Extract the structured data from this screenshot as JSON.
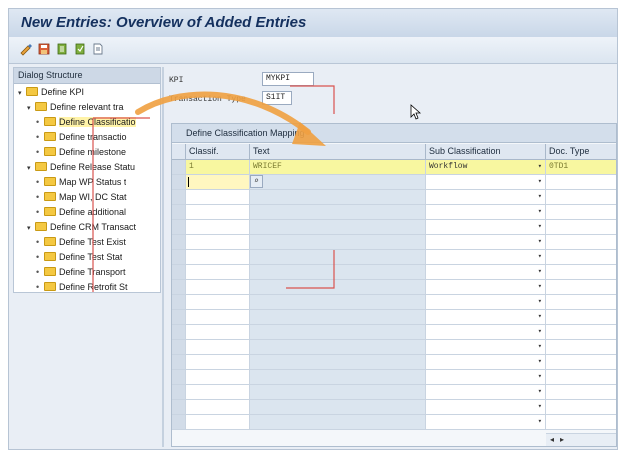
{
  "title": "New Entries: Overview of Added Entries",
  "toolbar": {
    "buttons": [
      "display-change-icon",
      "save-icon",
      "copy-icon",
      "select-all-icon",
      "document-icon"
    ]
  },
  "dialog": {
    "header": "Dialog Structure",
    "items": [
      {
        "level": 0,
        "type": "expanded",
        "label": "Define KPI"
      },
      {
        "level": 1,
        "type": "expanded",
        "label": "Define relevant tra"
      },
      {
        "level": 2,
        "type": "leaf",
        "label": "Define Classificatio",
        "selected": true
      },
      {
        "level": 2,
        "type": "leaf",
        "label": "Define transactio"
      },
      {
        "level": 2,
        "type": "leaf",
        "label": "Define milestone"
      },
      {
        "level": 1,
        "type": "expanded",
        "label": "Define Release Statu"
      },
      {
        "level": 2,
        "type": "leaf",
        "label": "Map WP Status t"
      },
      {
        "level": 2,
        "type": "leaf",
        "label": "Map WI, DC Stat"
      },
      {
        "level": 2,
        "type": "leaf",
        "label": "Define additional"
      },
      {
        "level": 1,
        "type": "expanded",
        "label": "Define CRM Transact"
      },
      {
        "level": 2,
        "type": "leaf",
        "label": "Define Test Exist"
      },
      {
        "level": 2,
        "type": "leaf",
        "label": "Define Test Stat"
      },
      {
        "level": 2,
        "type": "leaf",
        "label": "Define Transport"
      },
      {
        "level": 2,
        "type": "leaf",
        "label": "Define Retrofit St"
      }
    ]
  },
  "fields": {
    "kpi_label": "KPI",
    "kpi_value": "MYKPI",
    "trans_label": "Transaction Type",
    "trans_value": "S1IT"
  },
  "panel": {
    "title": "Define Classification Mapping",
    "columns": [
      "Classif.",
      "Text",
      "Sub Classification",
      "Doc. Type"
    ],
    "rows": [
      {
        "classif": "1",
        "text": "WRICEF",
        "sub": "Workflow",
        "doc": "0TD1"
      }
    ],
    "empty_rows": 17
  },
  "colors": {
    "highlight": "#f8f7a0",
    "arrow": "#f0a040",
    "annotation_line": "#d9534f"
  }
}
